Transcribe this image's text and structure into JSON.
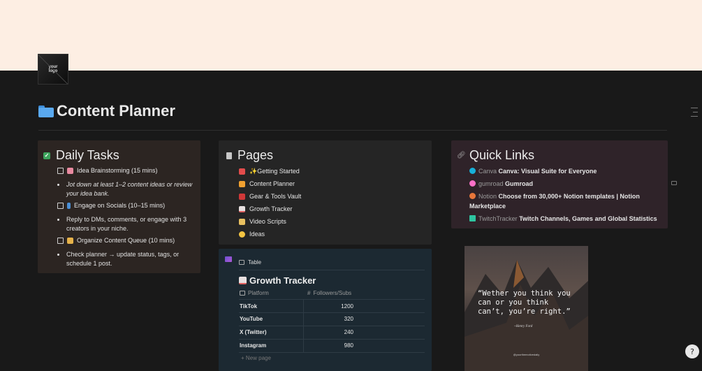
{
  "cover_color": "#fdeee3",
  "logo": {
    "text_line1": "your",
    "text_line2": "logo"
  },
  "page": {
    "icon": "folder-icon",
    "title": "Content Planner"
  },
  "daily_tasks": {
    "title": "Daily Tasks",
    "icon": "checkbox-icon",
    "items": [
      {
        "label": "Idea Brainstorming (15 mins)",
        "emoji": "brain-icon",
        "note": "Jot down at least 1–2 content ideas or review your idea bank."
      },
      {
        "label": "Engage on Socials (10–15 mins)",
        "emoji": "phone-icon",
        "note": "Reply to DMs, comments, or engage with 3 creators in your niche."
      },
      {
        "label": "Organize Content Queue (10 mins)",
        "emoji": "folder-icon",
        "note": "Check planner → update status, tags, or schedule 1 post."
      }
    ]
  },
  "pages": {
    "title": "Pages",
    "icon": "page-icon",
    "items": [
      {
        "label": "✨Getting Started",
        "icon": "rocket-icon",
        "color": "#e24c4c"
      },
      {
        "label": "Content Planner",
        "icon": "notebook-icon",
        "color": "#f0a030"
      },
      {
        "label": "Gear & Tools Vault",
        "icon": "toolbox-icon",
        "color": "#d03838"
      },
      {
        "label": "Growth Tracker",
        "icon": "chart-icon",
        "color": "#e06060"
      },
      {
        "label": "Video Scripts",
        "icon": "scroll-icon",
        "color": "#e8c060"
      },
      {
        "label": "Ideas",
        "icon": "lightbulb-icon",
        "color": "#f5c542"
      }
    ]
  },
  "quick_links": {
    "title": "Quick Links",
    "icon": "link-icon",
    "items": [
      {
        "source": "Canva",
        "title": "Canva: Visual Suite for Everyone",
        "color": "#17b0d8"
      },
      {
        "source": "gumroad",
        "title": "Gumroad",
        "color": "#ff70c8"
      },
      {
        "source": "Notion",
        "title": "Choose from 30,000+ Notion templates | Notion Marketplace",
        "color": "#e8763a"
      },
      {
        "source": "TwitchTracker",
        "title": "Twitch Channels, Games and Global Statistics",
        "color": "#2ec4a0"
      }
    ]
  },
  "growth_table": {
    "view_label": "Table",
    "title": "Growth Tracker",
    "col_platform": "Platform",
    "col_followers": "Followers/Subs",
    "rows": [
      {
        "platform": "TikTok",
        "followers": "1200"
      },
      {
        "platform": "YouTube",
        "followers": "320"
      },
      {
        "platform": "X (Twitter)",
        "followers": "240"
      },
      {
        "platform": "Instagram",
        "followers": "980"
      }
    ],
    "new_page": "+ New page"
  },
  "quote_image": {
    "quote": "“Wether you think you can or you think can’t, you’re right.”",
    "author": "~Henry Ford",
    "handle": "@yourthemotivedaily"
  },
  "help_label": "?"
}
